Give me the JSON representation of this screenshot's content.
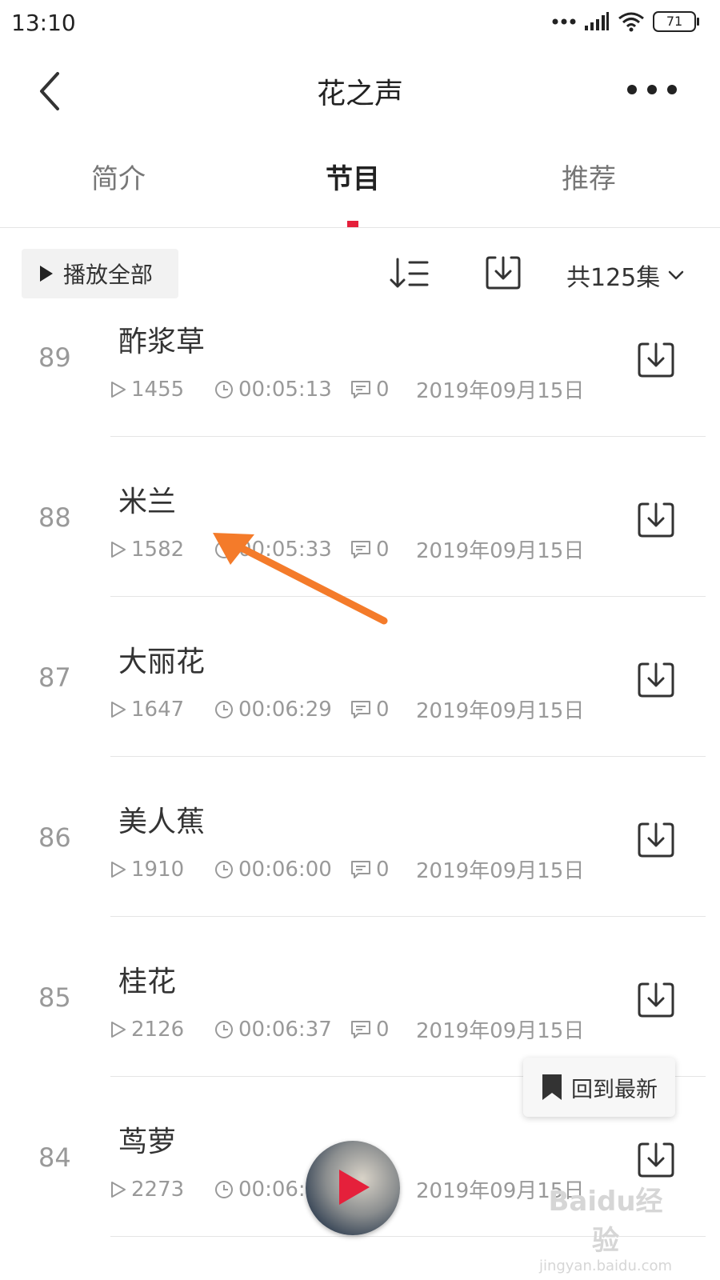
{
  "status_bar": {
    "time": "13:10",
    "battery": "71"
  },
  "header": {
    "title": "花之声",
    "back_icon": "chevron-left-icon",
    "more_icon": "more-dots-icon"
  },
  "tabs": [
    {
      "label": "简介",
      "active": false
    },
    {
      "label": "节目",
      "active": true
    },
    {
      "label": "推荐",
      "active": false
    }
  ],
  "accent_color": "#e5203b",
  "toolbar": {
    "play_all_label": "播放全部",
    "episode_count": "共125集"
  },
  "episodes": [
    {
      "num": "89",
      "title": "酢浆草",
      "plays": "1455",
      "duration": "00:05:13",
      "comments": "0",
      "date": "2019年09月15日"
    },
    {
      "num": "88",
      "title": "米兰",
      "plays": "1582",
      "duration": "00:05:33",
      "comments": "0",
      "date": "2019年09月15日"
    },
    {
      "num": "87",
      "title": "大丽花",
      "plays": "1647",
      "duration": "00:06:29",
      "comments": "0",
      "date": "2019年09月15日"
    },
    {
      "num": "86",
      "title": "美人蕉",
      "plays": "1910",
      "duration": "00:06:00",
      "comments": "0",
      "date": "2019年09月15日"
    },
    {
      "num": "85",
      "title": "桂花",
      "plays": "2126",
      "duration": "00:06:37",
      "comments": "0",
      "date": "2019年09月15日"
    },
    {
      "num": "84",
      "title": "茑萝",
      "plays": "2273",
      "duration": "00:06:",
      "comments": "",
      "date": "2019年09月15日"
    }
  ],
  "floating": {
    "back_to_latest_label": "回到最新"
  },
  "watermark": {
    "main": "Baidu经验",
    "sub": "jingyan.baidu.com"
  }
}
